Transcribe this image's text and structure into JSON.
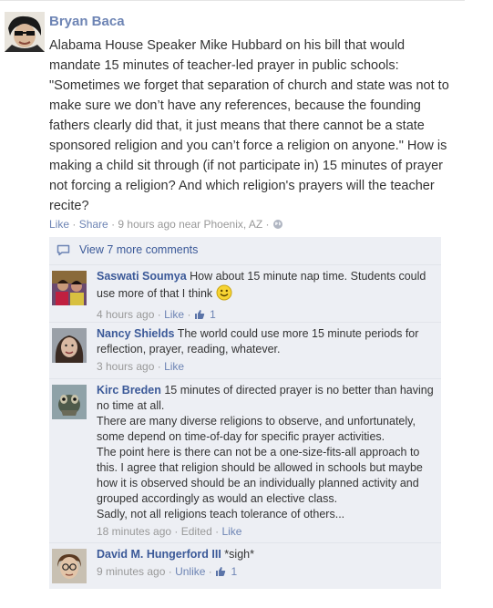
{
  "post": {
    "author": "Bryan Baca",
    "text": "Alabama House Speaker Mike Hubbard on his bill that would mandate 15 minutes of teacher-led prayer in public schools: \"Sometimes we forget that separation of church and state was not to make sure we don’t have any references, because the founding fathers clearly did that, it just means that there cannot be a state sponsored religion and you can’t force a religion on anyone.\" How is making a child sit through (if not participate in) 15 minutes of prayer not forcing a religion? And which religion's prayers will the teacher recite?",
    "like_label": "Like",
    "share_label": "Share",
    "time": "9 hours ago near Phoenix, AZ",
    "separator": "·",
    "audience_icon": "globe-icon"
  },
  "comments_panel": {
    "view_more_label": "View 7 more comments",
    "view_more_icon": "comment-bubble-icon",
    "comments": [
      {
        "author": "Saswati Soumya",
        "text": "How about 15 minute nap time. Students could use more of that I think",
        "emoticon": "smiley-icon",
        "time": "4 hours ago",
        "action": "Like",
        "like_count": "1"
      },
      {
        "author": "Nancy Shields",
        "text": "The world could use more 15 minute periods for reflection, prayer, reading, whatever.",
        "time": "3 hours ago",
        "action": "Like"
      },
      {
        "author": "Kirc Breden",
        "text": "15 minutes of directed prayer is no better than having no time at all.",
        "text_p2": "There are many diverse religions to observe, and unfortunately, some depend on time-of-day for specific prayer activities.",
        "text_p3": "The point here is there can not be a one-size-fits-all approach to this. I agree that religion should be allowed in schools but maybe how it is observed should be an individually planned activity and grouped accordingly as would an elective class.",
        "text_p4": "Sadly, not all religions teach tolerance of others...",
        "time": "18 minutes ago",
        "edited": "Edited",
        "action": "Like"
      },
      {
        "author": "David M. Hungerford III",
        "text": "*sigh*",
        "time": "9 minutes ago",
        "action": "Unlike",
        "like_count": "1"
      }
    ]
  },
  "colors": {
    "link_blue": "#3b5998",
    "meta_gray": "#999999",
    "panel_bg": "#edeff4"
  }
}
